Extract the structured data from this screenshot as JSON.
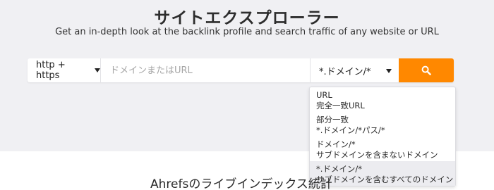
{
  "hero": {
    "title": "サイトエクスプローラー",
    "subtitle": "Get an in-depth look at the backlink profile and search traffic of any website or URL"
  },
  "search": {
    "protocol": "http + https",
    "placeholder": "ドメインまたはURL",
    "value": "",
    "mode": "*.ドメイン/*",
    "submit_icon": "search-icon",
    "accent_color": "#ff8800"
  },
  "dropdown": {
    "options": [
      {
        "line1": "URL",
        "line2": "完全一致URL"
      },
      {
        "line1": "部分一致",
        "line2": "*.ドメイン/*パス/*"
      },
      {
        "line1": "ドメイン/*",
        "line2": "サブドメインを含まないドメイン"
      },
      {
        "line1": "*.ドメイン/*",
        "line2": "サブドメインを含むすべてのドメイン"
      }
    ],
    "selected_index": 3
  },
  "section": {
    "title": "Ahrefsのライブインデックス統計"
  }
}
